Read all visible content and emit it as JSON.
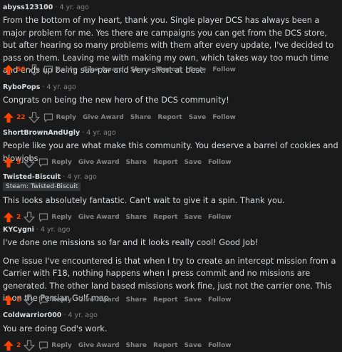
{
  "ui": {
    "up_color": "#ff4500",
    "icons": {
      "upvote": "arrow-up-icon",
      "downvote": "arrow-down-icon",
      "reply": "speech-bubble-icon"
    }
  },
  "comments": [
    {
      "author": "abyss123100",
      "time": "4 yr. ago",
      "paragraphs": [
        "From the bottom of my heart, thank you. Single player DCS has always been a major problem for me. Yes there are campaigns you can get from the DCS store, but after hearing so many problems with them after every update, I've decided to pass on them. Leaving me with making my own, which takes way too much time and ends up being sub-par and very short at best."
      ],
      "score": "60",
      "actions": {
        "reply": "Reply",
        "award": "Give Award",
        "share": "Share",
        "report": "Report",
        "save": "Save",
        "follow": "Follow"
      }
    },
    {
      "author": "RyboPops",
      "time": "4 yr. ago",
      "paragraphs": [
        "Congrats on being the new hero of the DCS community!"
      ],
      "score": "22",
      "actions": {
        "reply": "Reply",
        "award": "Give Award",
        "share": "Share",
        "report": "Report",
        "save": "Save",
        "follow": "Follow"
      }
    },
    {
      "author": "ShortBrownAndUgly",
      "time": "4 yr. ago",
      "paragraphs": [
        "People like you are what make this community. You deserve a barrel of cookies and blowjobs."
      ],
      "score": "5",
      "actions": {
        "reply": "Reply",
        "award": "Give Award",
        "share": "Share",
        "report": "Report",
        "save": "Save",
        "follow": "Follow"
      }
    },
    {
      "author": "Twisted-Biscuit",
      "time": "4 yr. ago",
      "flair": "Steam: Twisted-Biscuit",
      "paragraphs": [
        "This looks absolutely fantastic. Can't wait to give it a spin. Thank you."
      ],
      "score": "2",
      "actions": {
        "reply": "Reply",
        "award": "Give Award",
        "share": "Share",
        "report": "Report",
        "save": "Save",
        "follow": "Follow"
      }
    },
    {
      "author": "KYCygni",
      "time": "4 yr. ago",
      "paragraphs": [
        "I've done one missions so far and it looks really cool! Good Job!",
        "One issue I've encountered is that when I try to create an intercept mission from a Carrier with F18, nothing happens when I press commit and no missions are generated. The other land based missions work fine, just not the carrier one. This is on the Persian Gulf map."
      ],
      "score": "2",
      "actions": {
        "reply": "Reply",
        "award": "Give Award",
        "share": "Share",
        "report": "Report",
        "save": "Save",
        "follow": "Follow"
      }
    },
    {
      "author": "Coldwarrior000",
      "time": "4 yr. ago",
      "paragraphs": [
        "You are doing God's work."
      ],
      "score": "2",
      "actions": {
        "reply": "Reply",
        "award": "Give Award",
        "share": "Share",
        "report": "Report",
        "save": "Save",
        "follow": "Follow"
      }
    }
  ]
}
